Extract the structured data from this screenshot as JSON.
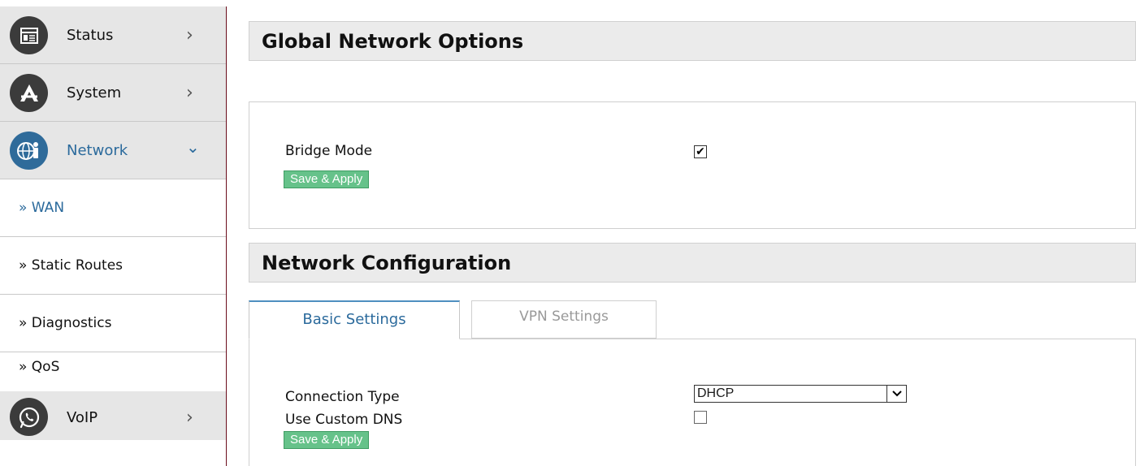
{
  "sidebar": {
    "items": [
      {
        "label": "Status",
        "icon": "status-icon",
        "chevron": "›"
      },
      {
        "label": "System",
        "icon": "system-icon",
        "chevron": "›"
      },
      {
        "label": "Network",
        "icon": "network-icon",
        "chevron": "⌄"
      }
    ],
    "subitems": [
      {
        "label": "» WAN"
      },
      {
        "label": "» Static Routes"
      },
      {
        "label": "» Diagnostics"
      },
      {
        "label": "» QoS"
      }
    ],
    "voip": {
      "label": "VoIP",
      "icon": "whatsapp-phone-icon",
      "chevron": "›"
    }
  },
  "global": {
    "title": "Global Network Options",
    "bridge_label": "Bridge Mode",
    "bridge_checked": "✔",
    "save_label": "Save & Apply"
  },
  "netconf": {
    "title": "Network Configuration",
    "tabs": [
      {
        "label": "Basic Settings"
      },
      {
        "label": "VPN Settings"
      }
    ],
    "connection_type_label": "Connection Type",
    "connection_type_value": "DHCP",
    "custom_dns_label": "Use Custom DNS",
    "save_label": "Save & Apply"
  },
  "colors": {
    "accent": "#2b6a9c",
    "button_green": "#66c28a",
    "sidebar_border": "#6b0d1c"
  }
}
